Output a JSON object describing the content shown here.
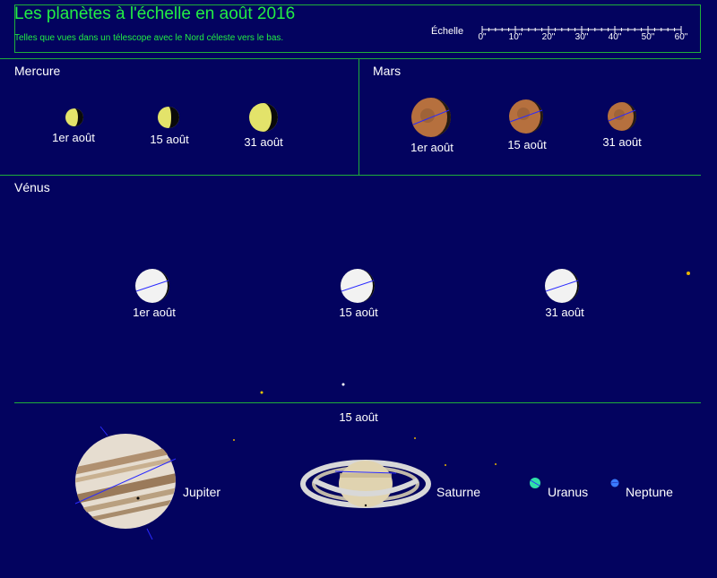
{
  "header": {
    "title": "Les planètes à l'échelle en août 2016",
    "subtitle": "Telles que vues dans un télescope avec le Nord céleste vers le bas.",
    "scale_label": "Échelle",
    "scale_ticks": [
      "0\"",
      "10\"",
      "20\"",
      "30\"",
      "40\"",
      "50\"",
      "60\""
    ]
  },
  "mercury": {
    "name": "Mercure",
    "dates": [
      "1er août",
      "15 août",
      "31 août"
    ]
  },
  "mars": {
    "name": "Mars",
    "dates": [
      "1er août",
      "15 août",
      "31 août"
    ]
  },
  "venus": {
    "name": "Vénus",
    "dates": [
      "1er août",
      "15 août",
      "31 août"
    ]
  },
  "outer": {
    "date": "15 août",
    "jupiter": "Jupiter",
    "saturn": "Saturne",
    "uranus": "Uranus",
    "neptune": "Neptune"
  },
  "colors": {
    "background": "#03035f",
    "frame": "#1fae3a",
    "title": "#22ee44",
    "mercury": "#e3e36a",
    "mars": "#b6703e",
    "venus": "#f2f2f2",
    "uranus": "#2fe1a8",
    "neptune": "#3a7bff"
  }
}
